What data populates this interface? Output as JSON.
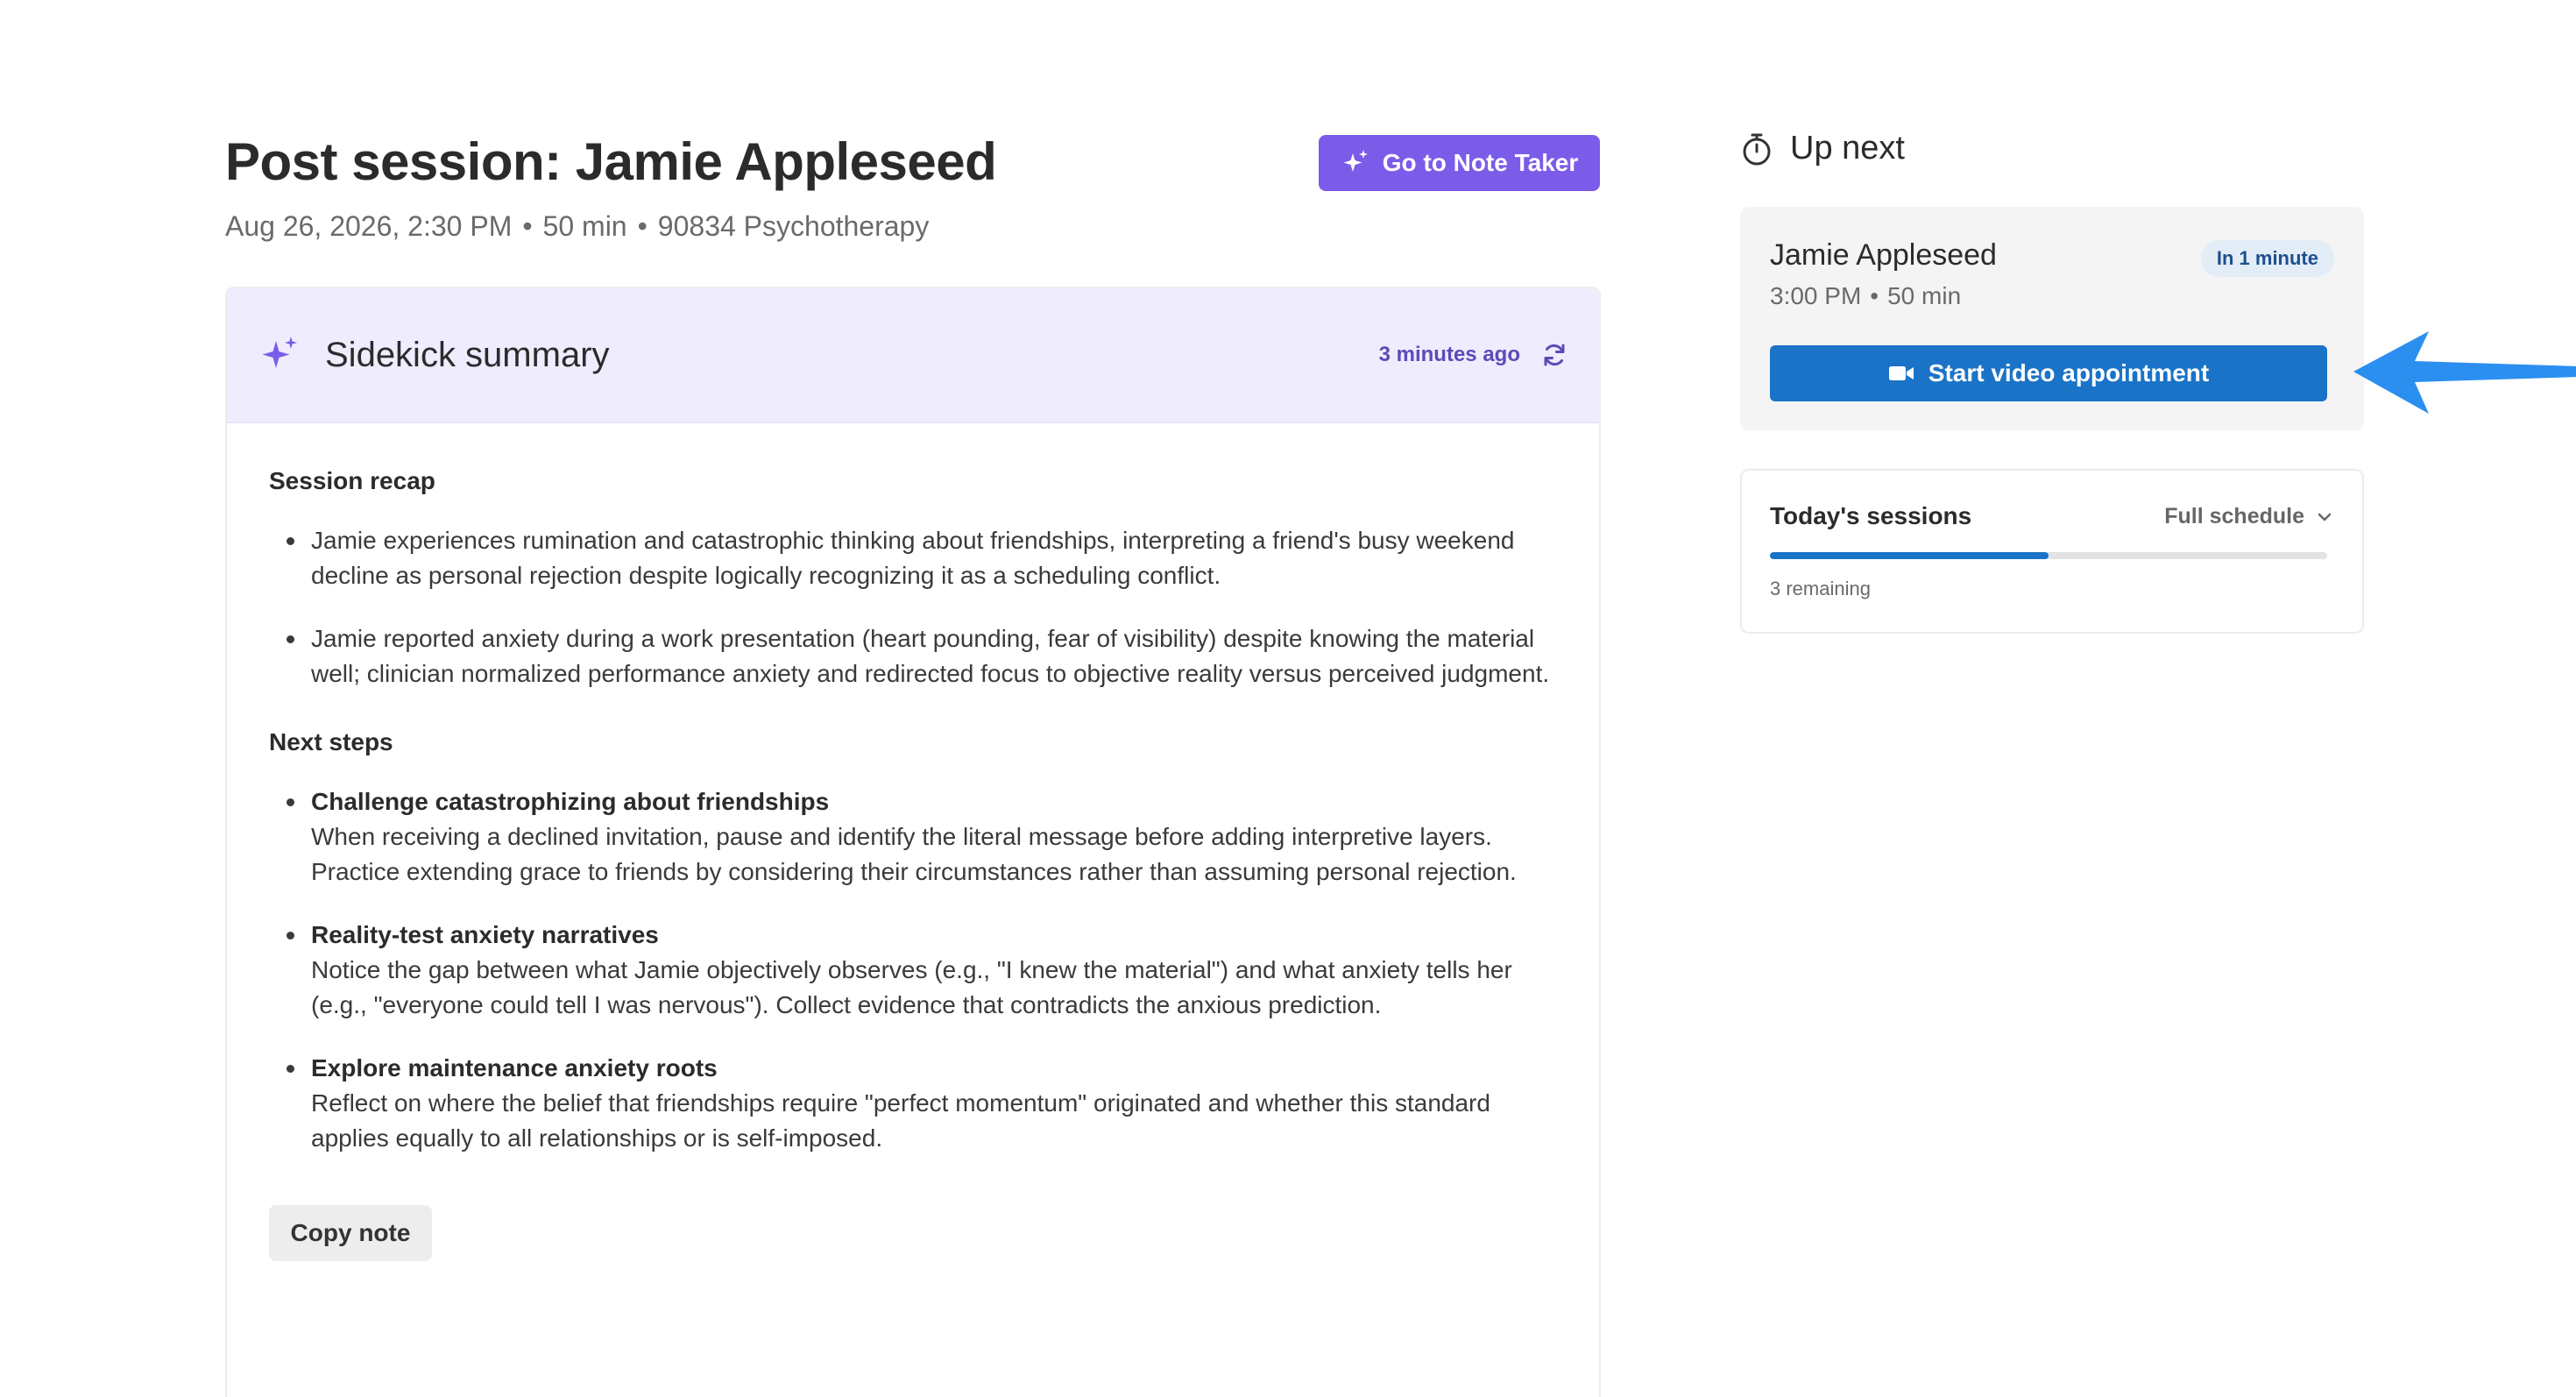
{
  "header": {
    "title": "Post session: Jamie Appleseed",
    "date": "Aug 26, 2026, 2:30 PM",
    "duration": "50 min",
    "code": "90834 Psychotherapy",
    "separator": "•",
    "note_taker_label": "Go to Note Taker"
  },
  "summary": {
    "title": "Sidekick summary",
    "updated": "3 minutes ago",
    "recap_heading": "Session recap",
    "recap": [
      "Jamie experiences rumination and catastrophic thinking about friendships, interpreting a friend's busy weekend decline as personal rejection despite logically recognizing it as a scheduling conflict.",
      "Jamie reported anxiety during a work presentation (heart pounding, fear of visibility) despite knowing the material well; clinician normalized performance anxiety and redirected focus to objective reality versus perceived judgment."
    ],
    "next_steps_heading": "Next steps",
    "next_steps": [
      {
        "title": "Challenge catastrophizing about friendships",
        "text": "When receiving a declined invitation, pause and identify the literal message before adding interpretive layers. Practice extending grace to friends by considering their circumstances rather than assuming personal rejection."
      },
      {
        "title": "Reality-test anxiety narratives",
        "text": "Notice the gap between what Jamie objectively observes (e.g., \"I knew the material\") and what anxiety tells her (e.g., \"everyone could tell I was nervous\"). Collect evidence that contradicts the anxious prediction."
      },
      {
        "title": "Explore maintenance anxiety roots",
        "text": "Reflect on where the belief that friendships require \"perfect momentum\" originated and whether this standard applies equally to all relationships or is self-imposed."
      }
    ],
    "copy_label": "Copy note"
  },
  "upnext": {
    "title": "Up next",
    "name": "Jamie Appleseed",
    "time": "3:00 PM",
    "duration": "50 min",
    "separator": "•",
    "badge": "In 1 minute",
    "video_label": "Start video appointment"
  },
  "sessions": {
    "title": "Today's sessions",
    "schedule_label": "Full schedule",
    "remaining": "3 remaining",
    "progress": 0.5
  },
  "colors": {
    "accent_purple": "#7b5ce9",
    "primary_blue": "#1a73c7",
    "summary_header_bg": "#efecfd",
    "annotation_arrow": "#2b8ff0"
  },
  "icons": {
    "note_taker": "sparkle-icon",
    "summary": "sparkle-icon",
    "refresh": "refresh-icon",
    "upnext": "stopwatch-icon",
    "video": "video-camera-icon",
    "schedule": "chevron-down-icon"
  }
}
